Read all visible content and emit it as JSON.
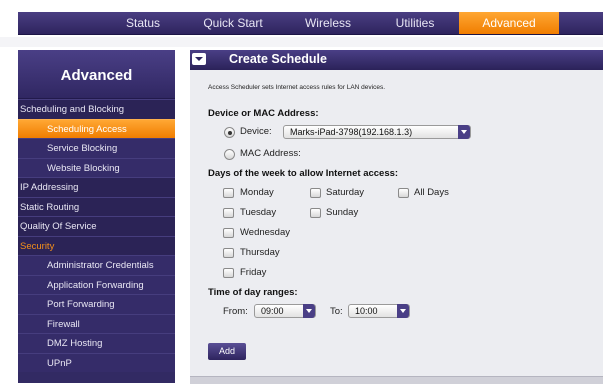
{
  "topnav": {
    "tabs": [
      {
        "label": "Status",
        "active": false
      },
      {
        "label": "Quick Start",
        "active": false
      },
      {
        "label": "Wireless",
        "active": false
      },
      {
        "label": "Utilities",
        "active": false
      },
      {
        "label": "Advanced",
        "active": true
      }
    ]
  },
  "sidebar": {
    "title": "Advanced",
    "items": [
      {
        "label": "Scheduling and Blocking",
        "level": 1,
        "active": false
      },
      {
        "label": "Scheduling Access",
        "level": 2,
        "active": true
      },
      {
        "label": "Service Blocking",
        "level": 2,
        "active": false
      },
      {
        "label": "Website Blocking",
        "level": 2,
        "active": false
      },
      {
        "label": "IP Addressing",
        "level": 1,
        "active": false
      },
      {
        "label": "Static Routing",
        "level": 1,
        "active": false
      },
      {
        "label": "Quality Of Service",
        "level": 1,
        "active": false
      },
      {
        "label": "Security",
        "level": 1,
        "active": false,
        "highlight": true
      },
      {
        "label": "Administrator Credentials",
        "level": 2,
        "active": false
      },
      {
        "label": "Application Forwarding",
        "level": 2,
        "active": false
      },
      {
        "label": "Port Forwarding",
        "level": 2,
        "active": false
      },
      {
        "label": "Firewall",
        "level": 2,
        "active": false
      },
      {
        "label": "DMZ Hosting",
        "level": 2,
        "active": false
      },
      {
        "label": "UPnP",
        "level": 2,
        "active": false
      }
    ]
  },
  "panel": {
    "title": "Create Schedule",
    "description": "Access Scheduler sets Internet access rules for LAN devices.",
    "device_section_label": "Device or MAC Address:",
    "device_option_label": "Device:",
    "device_selected": "Marks-iPad-3798(192.168.1.3)",
    "mac_option_label": "MAC Address:",
    "device_radio_checked": true,
    "days_section_label": "Days of the week to allow Internet access:",
    "days": {
      "monday": "Monday",
      "tuesday": "Tuesday",
      "wednesday": "Wednesday",
      "thursday": "Thursday",
      "friday": "Friday",
      "saturday": "Saturday",
      "sunday": "Sunday",
      "all_days": "All Days"
    },
    "time_section_label": "Time of day ranges:",
    "from_label": "From:",
    "from_value": "09:00",
    "to_label": "To:",
    "to_value": "10:00",
    "add_label": "Add"
  },
  "colors": {
    "accent": "#f28a0e",
    "nav_purple": "#2e245e",
    "panel_bg": "#ecedf1"
  }
}
